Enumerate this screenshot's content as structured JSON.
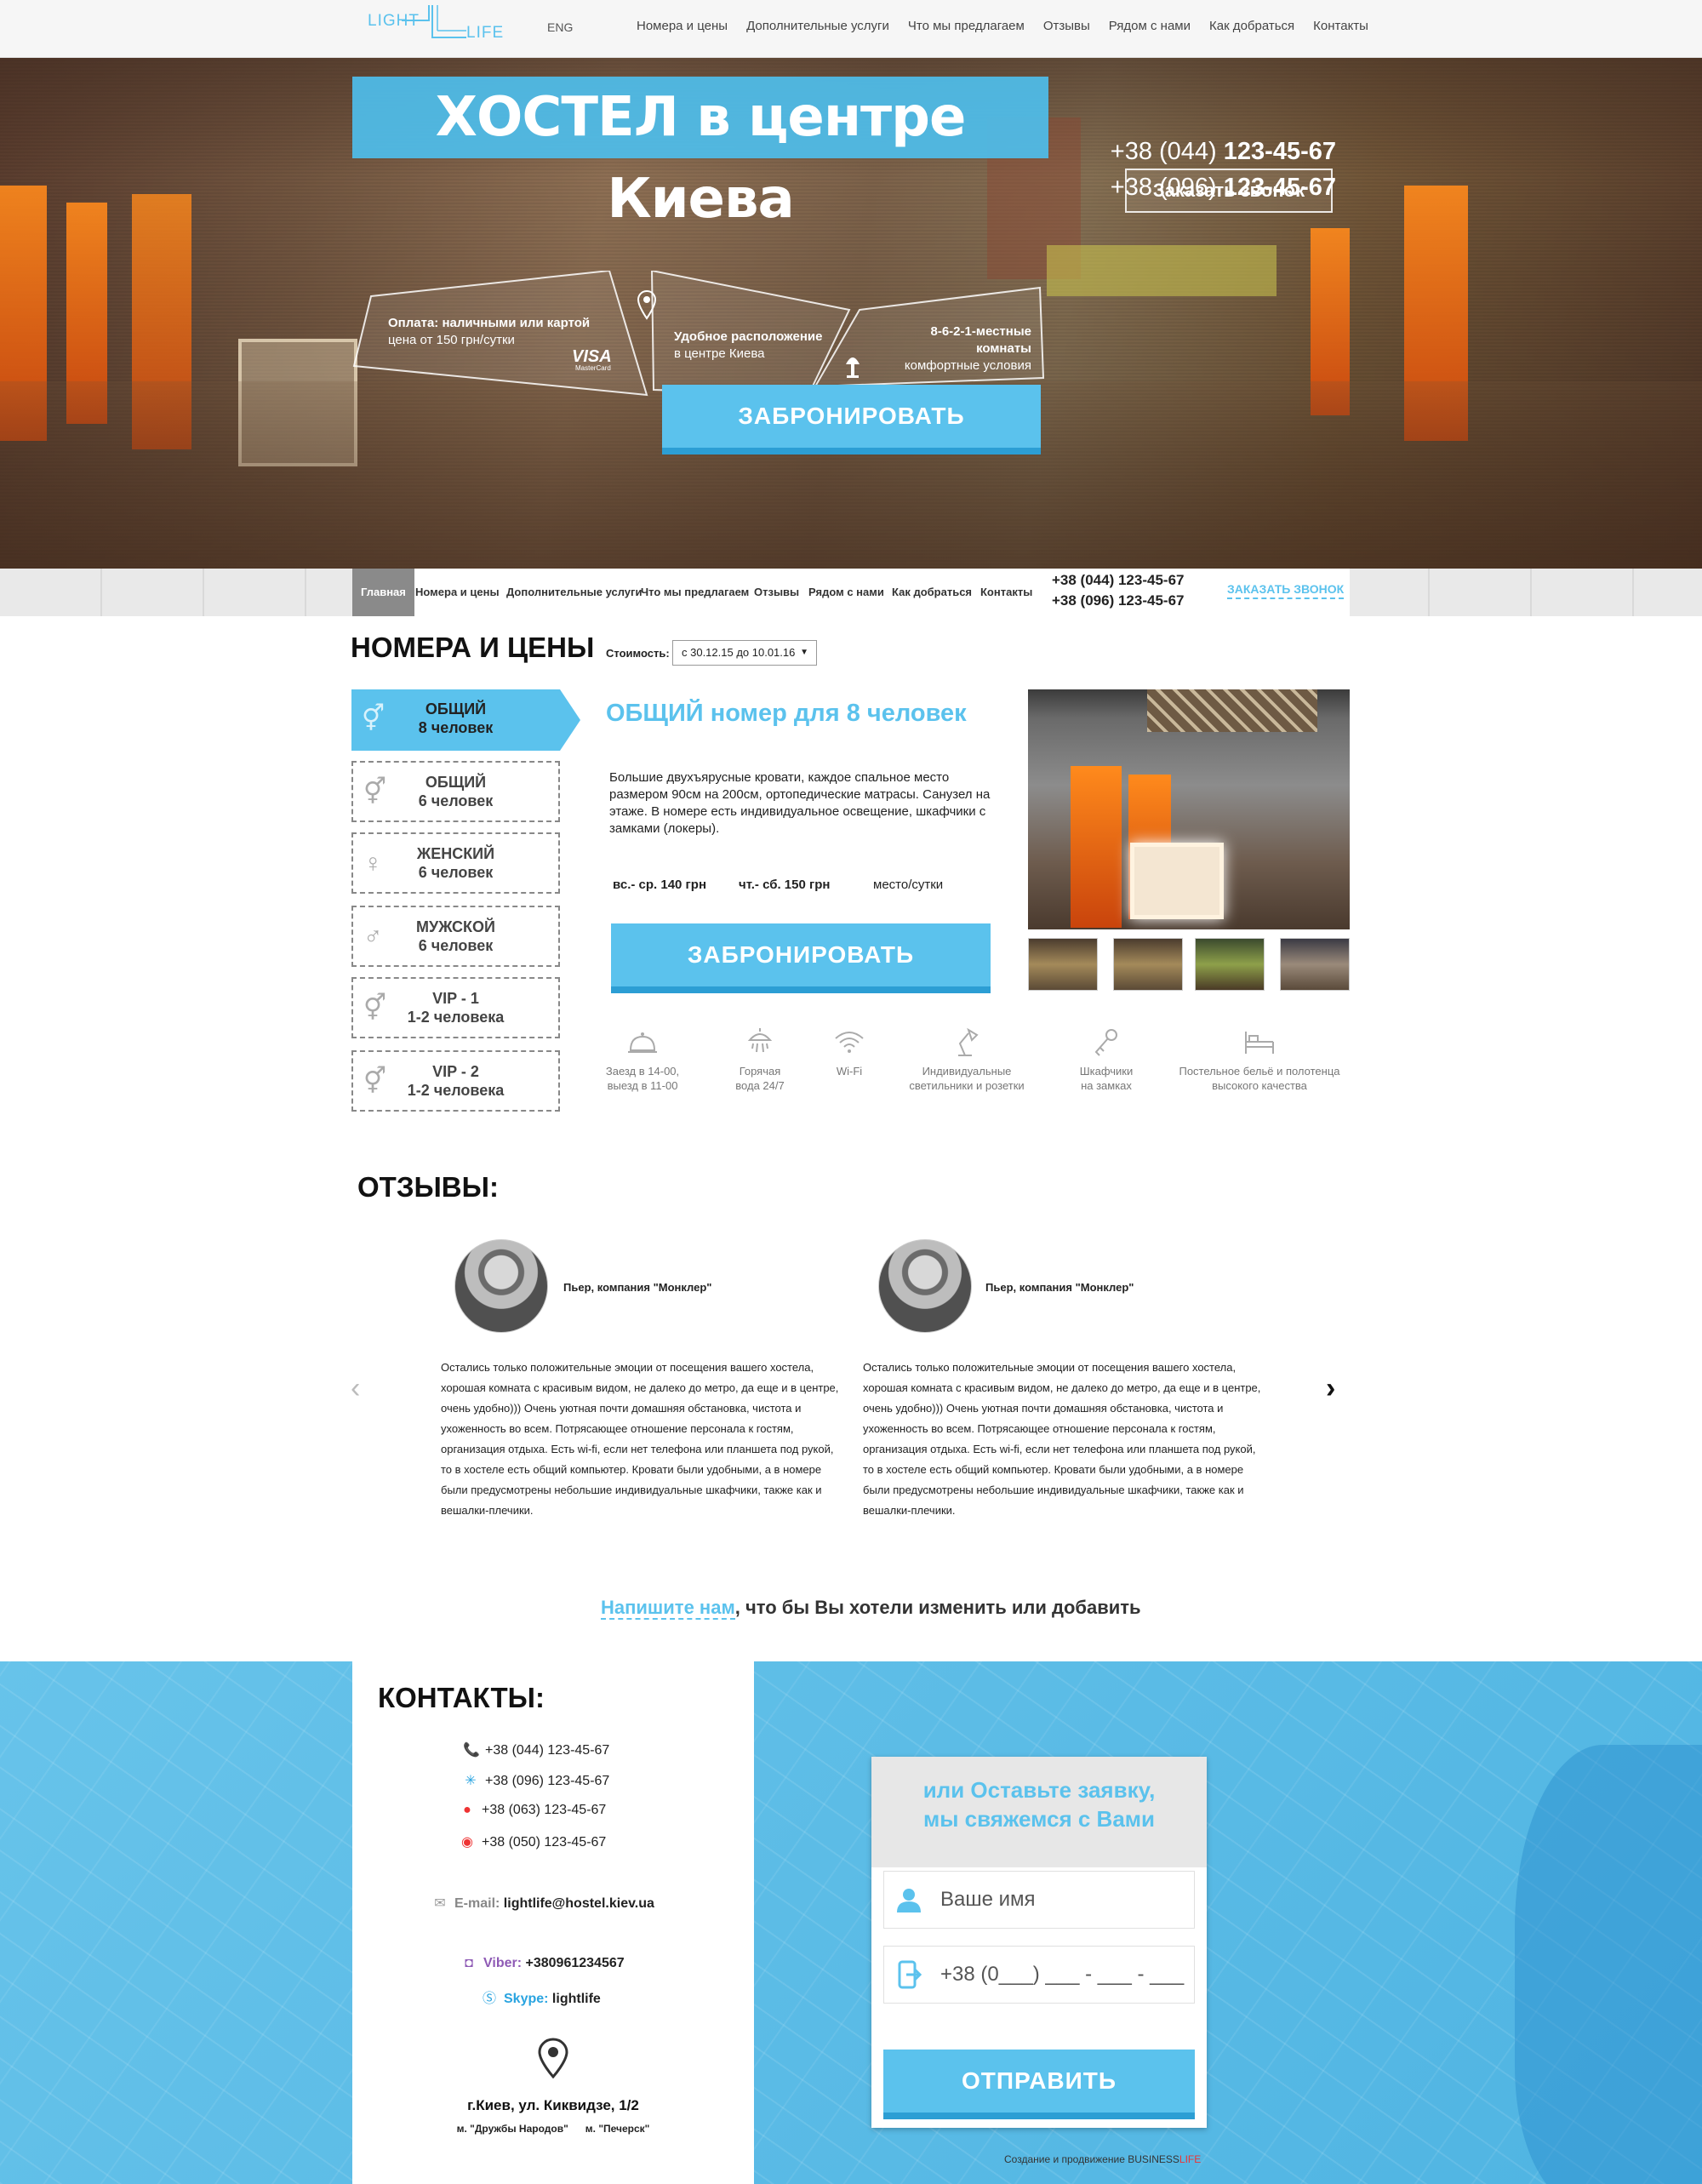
{
  "header": {
    "logo_top": "LIGHT",
    "logo_bottom": "LIFE",
    "lang": "ENG",
    "nav": [
      "Номера и цены",
      "Дополнительные услуги",
      "Что мы предлагаем",
      "Отзывы",
      "Рядом с нами",
      "Как добраться",
      "Контакты"
    ]
  },
  "hero": {
    "title": "ХОСТЕЛ в центре Киева",
    "phones": [
      {
        "prefix": "+38 (044)",
        "number": "123-45-67"
      },
      {
        "prefix": "+38 (096)",
        "number": "123-45-67"
      }
    ],
    "callback_label": "Заказать звонок",
    "features": [
      {
        "title": "Оплата: наличными или картой",
        "subtitle": "цена от 150 грн/сутки",
        "card_top": "VISA",
        "card_bottom": "MasterCard"
      },
      {
        "title": "Удобное расположение",
        "subtitle": "в центре Киева"
      },
      {
        "title": "8-6-2-1-местные комнаты",
        "subtitle": "комфортные условия"
      }
    ],
    "book_label": "ЗАБРОНИРОВАТЬ"
  },
  "subnav": {
    "items": [
      "Главная",
      "Номера и цены",
      "Дополнительные услуги",
      "Что мы предлагаем",
      "Отзывы",
      "Рядом с нами",
      "Как добраться",
      "Контакты"
    ],
    "phones": [
      "+38 (044) 123-45-67",
      "+38 (096) 123-45-67"
    ],
    "callback_label": "ЗАКАЗАТЬ ЗВОНОК"
  },
  "rooms": {
    "title": "НОМЕРА И ЦЕНЫ",
    "price_label": "Стоимость:",
    "price_period": "с 30.12.15 до 10.01.16",
    "tabs": [
      {
        "name": "ОБЩИЙ",
        "capacity": "8 человек"
      },
      {
        "name": "ОБЩИЙ",
        "capacity": "6 человек"
      },
      {
        "name": "ЖЕНСКИЙ",
        "capacity": "6 человек"
      },
      {
        "name": "МУЖСКОЙ",
        "capacity": "6 человек"
      },
      {
        "name": "VIP - 1",
        "capacity": "1-2 человека"
      },
      {
        "name": "VIP - 2",
        "capacity": "1-2 человека"
      }
    ],
    "selected": {
      "title": "ОБЩИЙ номер для 8 человек",
      "description": "Большие двухъярусные кровати, каждое спальное место размером 90см на 200см, ортопедические матрасы. Санузел на этаже. В номере есть индивидуальное освещение, шкафчики с замками (локеры).",
      "price_weekday": "вс.- ср. 140 грн",
      "price_weekend": "чт.- сб. 150 грн",
      "price_unit": "место/сутки",
      "book_label": "ЗАБРОНИРОВАТЬ"
    },
    "amenities": [
      {
        "icon": "bell-icon",
        "line1": "Заезд в 14-00,",
        "line2": "выезд в 11-00"
      },
      {
        "icon": "shower-icon",
        "line1": "Горячая",
        "line2": "вода 24/7"
      },
      {
        "icon": "wifi-icon",
        "line1": "Wi-Fi",
        "line2": ""
      },
      {
        "icon": "lamp-icon",
        "line1": "Индивидуальные",
        "line2": "светильники и розетки"
      },
      {
        "icon": "key-icon",
        "line1": "Шкафчики",
        "line2": "на замках"
      },
      {
        "icon": "bed-icon",
        "line1": "Постельное бельё и полотенца",
        "line2": "высокого качества"
      }
    ]
  },
  "reviews": {
    "title": "ОТЗЫВЫ:",
    "items": [
      {
        "author": "Пьер, компания \"Монклер\"",
        "text": "Остались только положительные эмоции от посещения вашего хостела, хорошая комната с красивым видом, не далеко до метро, да еще и в центре, очень удобно))) Очень уютная почти домашняя обстановка, чистота и ухоженность во всем. Потрясающее отношение персонала к гостям, организация отдыха. Есть wi-fi, если нет телефона или планшета под рукой, то в хостеле есть общий компьютер. Кровати были удобными, а в номере были предусмотрены небольшие индивидуальные шкафчики, также как и вешалки-плечики."
      },
      {
        "author": "Пьер, компания \"Монклер\"",
        "text": "Остались только положительные эмоции от посещения вашего хостела, хорошая комната с красивым видом, не далеко до метро, да еще и в центре, очень удобно))) Очень уютная почти домашняя обстановка, чистота и ухоженность во всем. Потрясающее отношение персонала к гостям, организация отдыха. Есть wi-fi, если нет телефона или планшета под рукой, то в хостеле есть общий компьютер. Кровати были удобными, а в номере были предусмотрены небольшие индивидуальные шкафчики, также как и вешалки-плечики."
      }
    ],
    "prev": "‹",
    "next": "›"
  },
  "write_us": {
    "link": "Напишите нам",
    "rest": ", что бы Вы хотели изменить или добавить"
  },
  "contacts": {
    "title": "КОНТАКТЫ:",
    "phones": [
      "+38 (044) 123-45-67",
      "+38 (096) 123-45-67",
      "+38 (063) 123-45-67",
      "+38 (050) 123-45-67"
    ],
    "email_label": "E-mail:",
    "email": "lightlife@hostel.kiev.ua",
    "viber_label": "Viber:",
    "viber": "+380961234567",
    "skype_label": "Skype:",
    "skype": "lightlife",
    "address": "г.Киев, ул. Киквидзе, 1/2",
    "metro": "м. \"Дружбы Народов\"      м. \"Печерск\""
  },
  "form": {
    "title_line1": "или Оставьте заявку,",
    "title_line2": "мы свяжемся с Вами",
    "name_placeholder": "Ваше имя",
    "phone_placeholder": "+38 (0___) ___ - ___ - ___",
    "send_label": "ОТПРАВИТЬ"
  },
  "footer": {
    "credit_text": "Создание и продвижение",
    "credit_brand": "BUSINESS",
    "credit_brand_red": "LIFE"
  },
  "colors": {
    "accent": "#5bc2ed",
    "accent_dark": "#2c9ed4"
  }
}
